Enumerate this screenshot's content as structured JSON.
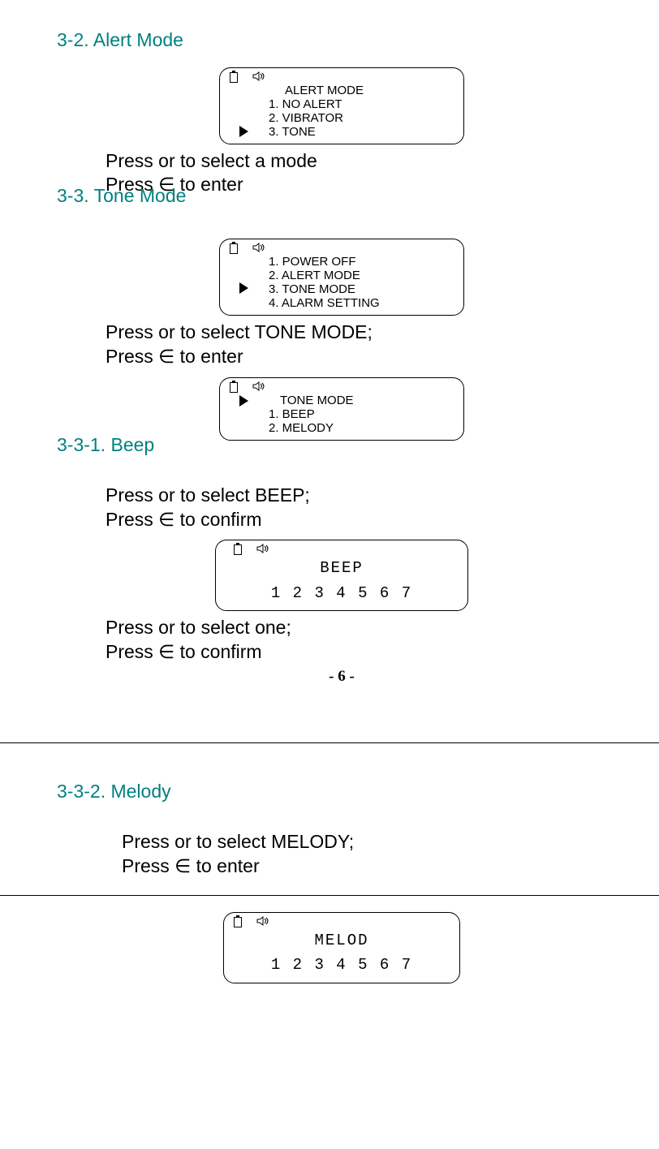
{
  "s32": {
    "heading": "3-2. Alert Mode",
    "lcd": {
      "title": "ALERT MODE",
      "l1": "1. NO ALERT",
      "l2": "2. VIBRATOR",
      "l3": "3. TONE"
    },
    "instr1": "Press   or   to select a mode",
    "instr2": "Press ∈ to enter"
  },
  "s33": {
    "heading": "3-3. Tone Mode",
    "lcd1": {
      "l1": "1. POWER OFF",
      "l2": "2. ALERT MODE",
      "l3": "3. TONE MODE",
      "l4": "4. ALARM SETTING"
    },
    "instr1": "Press  or    to select TONE MODE;",
    "instr2": "Press ∈ to enter",
    "lcd2": {
      "title": "TONE MODE",
      "l1": "1.   BEEP",
      "l2": "2.  MELODY"
    }
  },
  "s331": {
    "heading": "3-3-1. Beep",
    "instr1": "Press   or   to select BEEP;",
    "instr2": "Press  ∈ to confirm",
    "lcd": {
      "title": "BEEP",
      "nums": "1 2 3 4 5 6 7"
    },
    "instr3": "Press  or    to select one;",
    "instr4": "Press ∈ to confirm"
  },
  "pagenum": "- 6 -",
  "s332": {
    "heading": "3-3-2. Melody",
    "instr1": "Press  or    to select MELODY;",
    "instr2": "Press ∈ to enter",
    "lcd": {
      "title": "MELOD",
      "nums": "1 2 3 4 5 6 7"
    }
  }
}
